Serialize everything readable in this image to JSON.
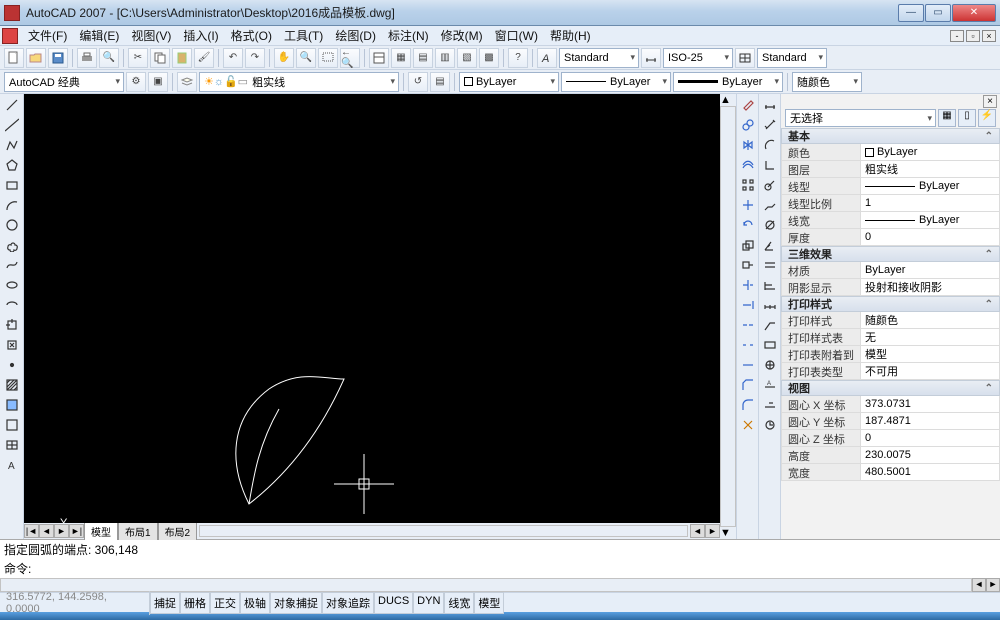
{
  "title": "AutoCAD 2007 - [C:\\Users\\Administrator\\Desktop\\2016成品模板.dwg]",
  "menu": {
    "file": "文件(F)",
    "edit": "编辑(E)",
    "view": "视图(V)",
    "insert": "插入(I)",
    "format": "格式(O)",
    "tools": "工具(T)",
    "draw": "绘图(D)",
    "dimension": "标注(N)",
    "modify": "修改(M)",
    "window": "窗口(W)",
    "help": "帮助(H)"
  },
  "toolbars": {
    "style_text": "Standard",
    "style_dim": "ISO-25",
    "style_table": "Standard",
    "workspace": "AutoCAD 经典",
    "layer_name": "粗实线",
    "color_combo": "ByLayer",
    "ltype_combo": "ByLayer",
    "lweight_combo": "ByLayer",
    "plot_color": "随颜色"
  },
  "palette": {
    "selector": "无选择",
    "sections": {
      "basic": "基本",
      "threeD": "三维效果",
      "plot": "打印样式",
      "view": "视图"
    },
    "basic": {
      "color_k": "颜色",
      "color_v": "ByLayer",
      "layer_k": "图层",
      "layer_v": "粗实线",
      "ltype_k": "线型",
      "ltype_v": "ByLayer",
      "ltscale_k": "线型比例",
      "ltscale_v": "1",
      "lweight_k": "线宽",
      "lweight_v": "ByLayer",
      "thick_k": "厚度",
      "thick_v": "0"
    },
    "threeD": {
      "material_k": "材质",
      "material_v": "ByLayer",
      "shadow_k": "阴影显示",
      "shadow_v": "投射和接收阴影"
    },
    "plot": {
      "pstyle_k": "打印样式",
      "pstyle_v": "随颜色",
      "ptable_k": "打印样式表",
      "ptable_v": "无",
      "pattach_k": "打印表附着到",
      "pattach_v": "模型",
      "ptype_k": "打印表类型",
      "ptype_v": "不可用"
    },
    "view": {
      "cx_k": "圆心 X 坐标",
      "cx_v": "373.0731",
      "cy_k": "圆心 Y 坐标",
      "cy_v": "187.4871",
      "cz_k": "圆心 Z 坐标",
      "cz_v": "0",
      "h_k": "高度",
      "h_v": "230.0075",
      "w_k": "宽度",
      "w_v": "480.5001"
    }
  },
  "tabs": {
    "model": "模型",
    "layout1": "布局1",
    "layout2": "布局2"
  },
  "cmd": {
    "history": "指定圆弧的端点: 306,148",
    "prompt": "命令: "
  },
  "status": {
    "coords": "316.5772, 144.2598, 0.0000",
    "toggles": [
      "捕捉",
      "栅格",
      "正交",
      "极轴",
      "对象捕捉",
      "对象追踪",
      "DUCS",
      "DYN",
      "线宽",
      "模型"
    ]
  }
}
